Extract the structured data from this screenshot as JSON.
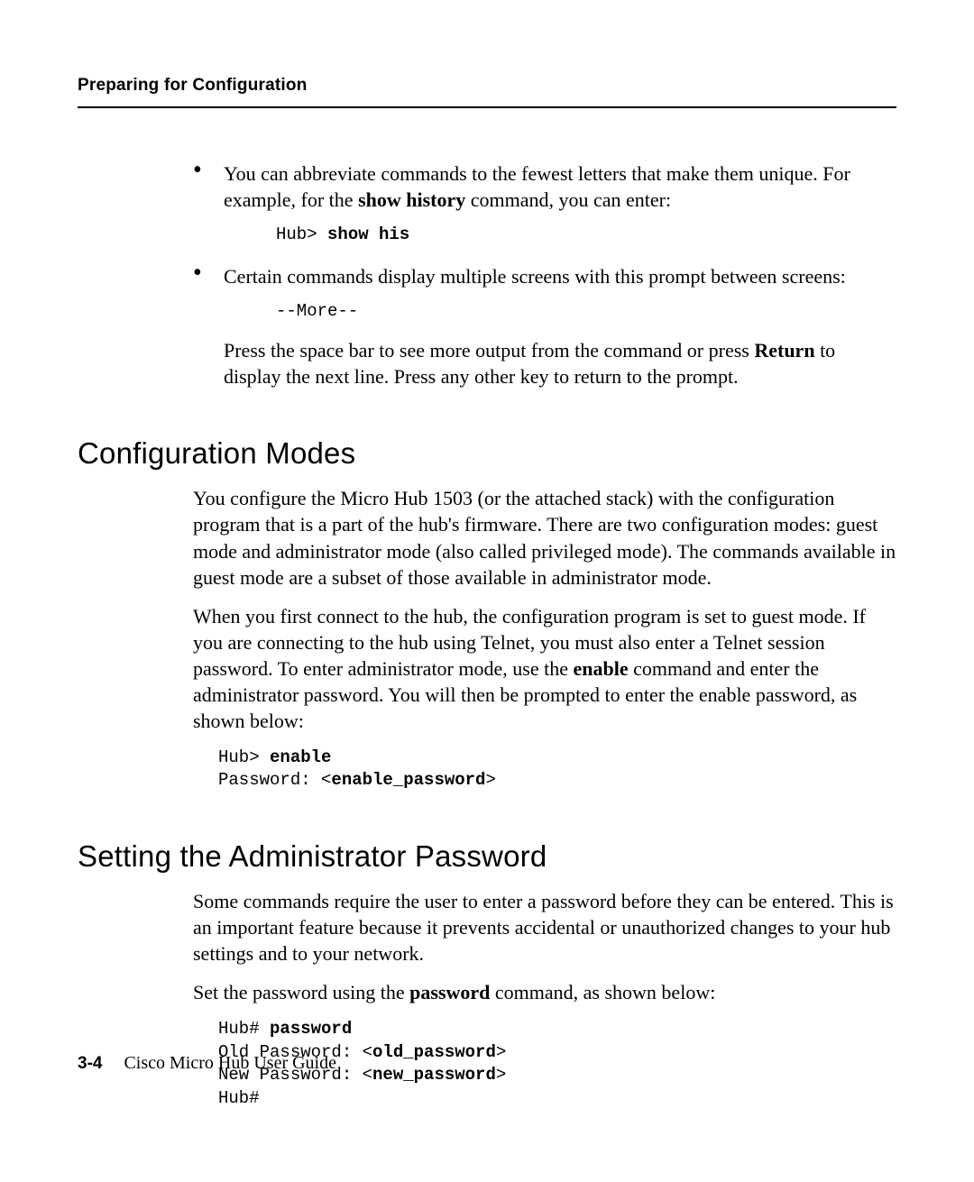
{
  "header": {
    "running_head": "Preparing for Configuration"
  },
  "bullets": {
    "b1_text_a": "You can abbreviate commands to the fewest letters that make them unique. For example, for the ",
    "b1_cmd": "show history",
    "b1_text_b": " command, you can enter:",
    "b1_code_prompt": "Hub> ",
    "b1_code_cmd": "show his",
    "b2_text": "Certain commands display multiple screens with this prompt between screens:",
    "b2_code": "--More--",
    "b2_follow_a": "Press the space bar to see more output from the command or press ",
    "b2_return": "Return",
    "b2_follow_b": " to display the next line. Press any other key to return to the prompt."
  },
  "section_config": {
    "heading": "Configuration Modes",
    "p1": "You configure the Micro Hub 1503 (or the attached stack) with the configuration program that is a part of the hub's firmware. There are two configuration modes: guest mode and administrator mode (also called privileged mode). The commands available in guest mode are a subset of those available in administrator mode.",
    "p2a": "When you first connect to the hub, the configuration program is set to guest mode. If you are connecting to the hub using Telnet, you must also enter a Telnet session password. To enter administrator mode, use the ",
    "p2cmd": "enable",
    "p2b": " command and enter the administrator password. You will then be prompted to enter the enable password, as shown below:",
    "code_l1_prompt": "Hub> ",
    "code_l1_cmd": "enable",
    "code_l2_label": "Password: <",
    "code_l2_val": "enable_password",
    "code_l2_end": ">"
  },
  "section_admin": {
    "heading": "Setting the Administrator Password",
    "p1": "Some commands require the user to enter a password before they can be entered. This is an important feature because it prevents accidental or unauthorized changes to your hub settings and to your network.",
    "p2a": "Set the password using the ",
    "p2cmd": "password",
    "p2b": " command, as shown below:",
    "code_l1_prompt": "Hub# ",
    "code_l1_cmd": "password",
    "code_l2_label": "Old Password: <",
    "code_l2_val": "old_password",
    "code_l2_end": ">",
    "code_l3_label": "New Password: <",
    "code_l3_val": "new_password",
    "code_l3_end": ">",
    "code_l4": "Hub#"
  },
  "footer": {
    "page_num": "3-4",
    "book": "Cisco Micro Hub User Guide"
  }
}
